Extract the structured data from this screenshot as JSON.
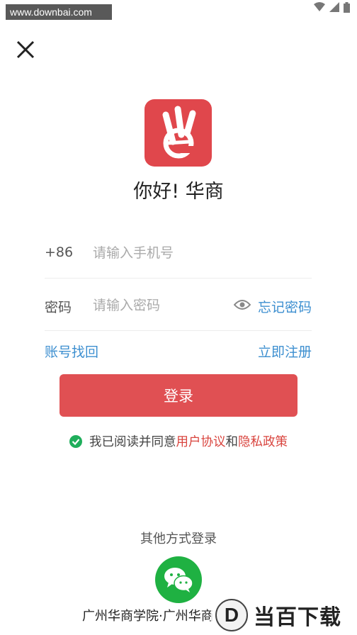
{
  "watermark_top": "www.downbai.com",
  "close_icon": "close-icon",
  "logo_icon": "huashang-logo",
  "greeting": "你好! 华商",
  "phone": {
    "prefix": "+86",
    "placeholder": "请输入手机号"
  },
  "password": {
    "label": "密码",
    "placeholder": "请输入密码",
    "forgot": "忘记密码"
  },
  "links": {
    "find_account": "账号找回",
    "register": "立即注册"
  },
  "login_button": "登录",
  "agreement": {
    "prefix": "我已阅读并同意",
    "user_agreement": "用户协议",
    "and": "和",
    "privacy_policy": "隐私政策"
  },
  "other_login": "其他方式登录",
  "wechat_icon": "wechat-icon",
  "footer": "广州华商学院·广州华商",
  "brand_watermark": {
    "letter": "D",
    "text": "当百下载"
  },
  "colors": {
    "accent_red": "#e05053",
    "link_blue": "#3d8fd0",
    "check_green": "#1fae5b",
    "wechat_green": "#1fb142"
  }
}
